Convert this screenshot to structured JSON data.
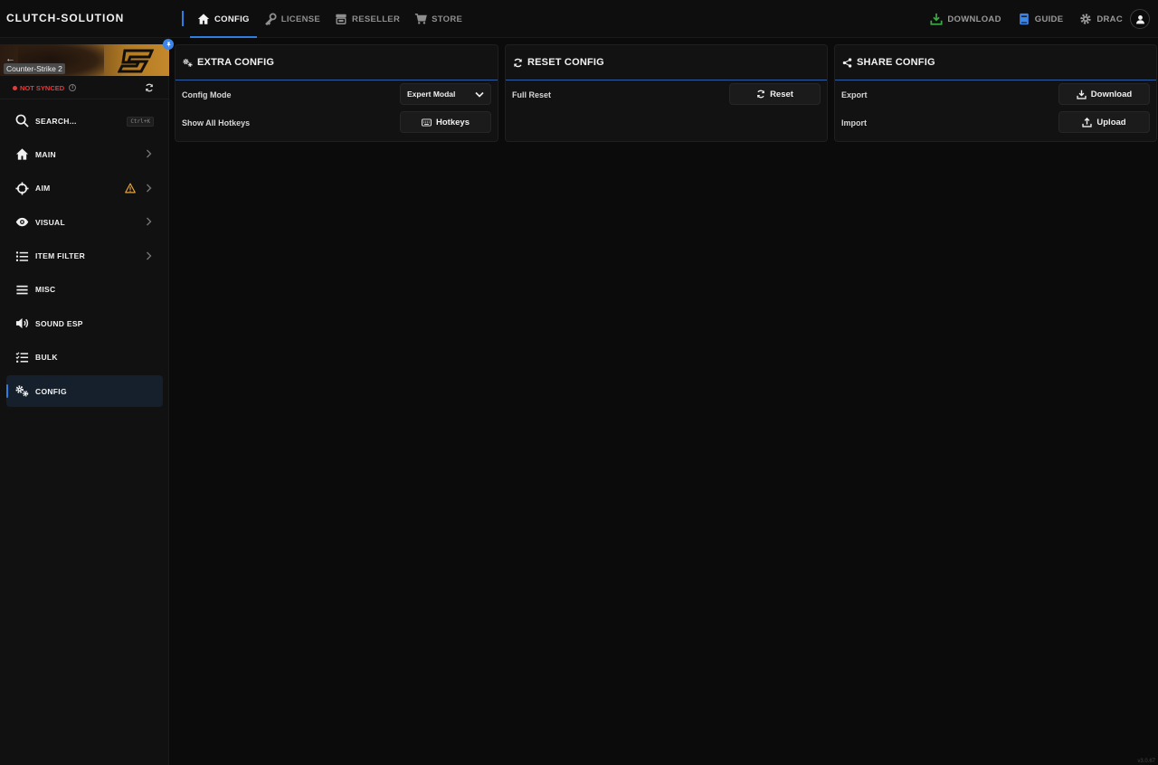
{
  "brand": "CLUTCH-SOLUTION",
  "nav": [
    {
      "label": "CONFIG",
      "icon": "home-icon"
    },
    {
      "label": "LICENSE",
      "icon": "key-icon"
    },
    {
      "label": "RESELLER",
      "icon": "store-icon"
    },
    {
      "label": "STORE",
      "icon": "cart-icon"
    }
  ],
  "top_right": {
    "download": "DOWNLOAD",
    "guide": "GUIDE",
    "user": "DRAC"
  },
  "sidebar": {
    "game_name": "Counter-Strike 2",
    "sync_status": "NOT SYNCED",
    "search_label": "SEARCH...",
    "search_shortcut": "Ctrl+K",
    "items": [
      {
        "label": "MAIN"
      },
      {
        "label": "AIM"
      },
      {
        "label": "VISUAL"
      },
      {
        "label": "ITEM FILTER"
      },
      {
        "label": "MISC"
      },
      {
        "label": "SOUND ESP"
      },
      {
        "label": "BULK"
      },
      {
        "label": "CONFIG"
      }
    ]
  },
  "cards": {
    "extra": {
      "title": "EXTRA CONFIG",
      "mode_label": "Config Mode",
      "mode_value": "Expert Modal",
      "hotkeys_label": "Show All Hotkeys",
      "hotkeys_button": "Hotkeys"
    },
    "reset": {
      "title": "RESET CONFIG",
      "full_reset_label": "Full Reset",
      "reset_button": "Reset"
    },
    "share": {
      "title": "SHARE CONFIG",
      "export_label": "Export",
      "download_button": "Download",
      "import_label": "Import",
      "upload_button": "Upload"
    }
  },
  "version": "v3.0.67",
  "colors": {
    "accent": "#2f7de0",
    "danger": "#e23b3b",
    "warning": "#e8a33b",
    "download_green": "#3aa845",
    "guide_blue": "#3b86e8"
  }
}
